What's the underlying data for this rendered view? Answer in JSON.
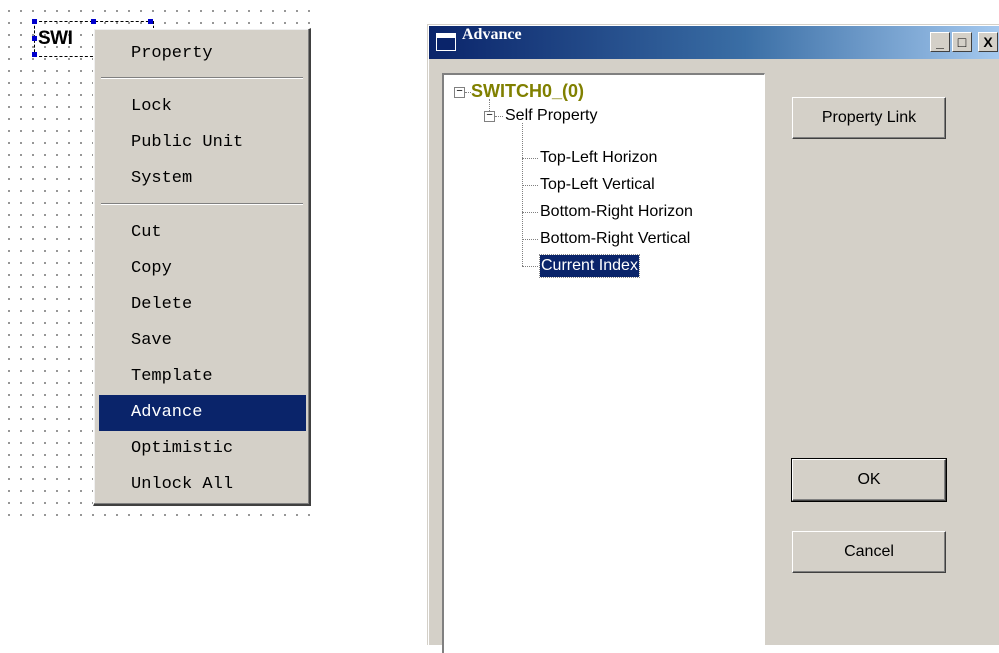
{
  "canvas": {
    "widget_label": "SWI"
  },
  "context_menu": {
    "groups": [
      [
        "Property"
      ],
      [
        "Lock",
        "Public Unit",
        "System"
      ],
      [
        "Cut",
        "Copy",
        "Delete",
        "Save",
        "Template",
        "Advance",
        "Optimistic",
        "Unlock All"
      ]
    ],
    "items": {
      "property": "Property",
      "lock": "Lock",
      "public_unit": "Public Unit",
      "system": "System",
      "cut": "Cut",
      "copy": "Copy",
      "delete": "Delete",
      "save": "Save",
      "template": "Template",
      "advance": "Advance",
      "optimistic": "Optimistic",
      "unlock_all": "Unlock All"
    },
    "highlighted": "Advance"
  },
  "dialog": {
    "title": "Advance",
    "titlebar_buttons": {
      "minimize": "_",
      "maximize": "□",
      "close": "X"
    },
    "tree": {
      "root": "SWITCH0_(0)",
      "group": "Self Property",
      "children": [
        "Top-Left Horizon",
        "Top-Left Vertical",
        "Bottom-Right Horizon",
        "Bottom-Right Vertical",
        "Current Index"
      ],
      "selected": "Current Index",
      "root_color": "#808000"
    },
    "buttons": {
      "property_link": "Property Link",
      "ok": "OK",
      "cancel": "Cancel"
    }
  },
  "colors": {
    "selection": "#0a246a",
    "face": "#d4d0c8",
    "titlebar_start": "#0a246a",
    "titlebar_end": "#a6caf0"
  }
}
